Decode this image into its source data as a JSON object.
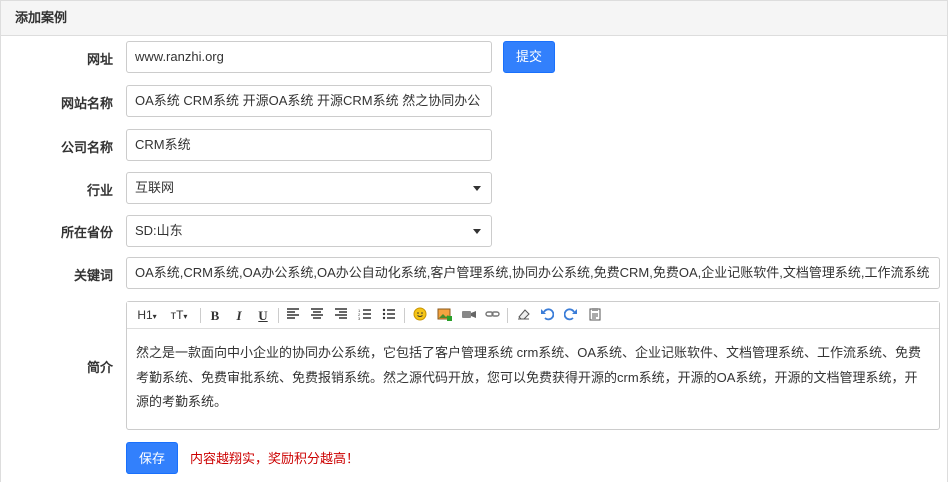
{
  "panel": {
    "title": "添加案例"
  },
  "form": {
    "url": {
      "label": "网址",
      "value": "www.ranzhi.org"
    },
    "submit_label": "提交",
    "site_name": {
      "label": "网站名称",
      "value": "OA系统 CRM系统 开源OA系统 开源CRM系统 然之协同办公"
    },
    "company": {
      "label": "公司名称",
      "value": "CRM系统"
    },
    "industry": {
      "label": "行业",
      "value": "互联网"
    },
    "province": {
      "label": "所在省份",
      "value": "SD:山东"
    },
    "keywords": {
      "label": "关键词",
      "value": "OA系统,CRM系统,OA办公系统,OA办公自动化系统,客户管理系统,协同办公系统,免费CRM,免费OA,企业记账软件,文档管理系统,工作流系统"
    },
    "intro": {
      "label": "简介",
      "content": "然之是一款面向中小企业的协同办公系统，它包括了客户管理系统 crm系统、OA系统、企业记账软件、文档管理系统、工作流系统、免费考勤系统、免费审批系统、免费报销系统。然之源代码开放，您可以免费获得开源的crm系统，开源的OA系统，开源的文档管理系统，开源的考勤系统。",
      "toolbar": {
        "heading": "H1",
        "fontsize": "тT",
        "bold": "B",
        "italic": "I",
        "underline": "U"
      }
    },
    "save_label": "保存",
    "hint": "内容越翔实，奖励积分越高！"
  },
  "colors": {
    "primary": "#3280fc",
    "hint": "#cc0000"
  }
}
